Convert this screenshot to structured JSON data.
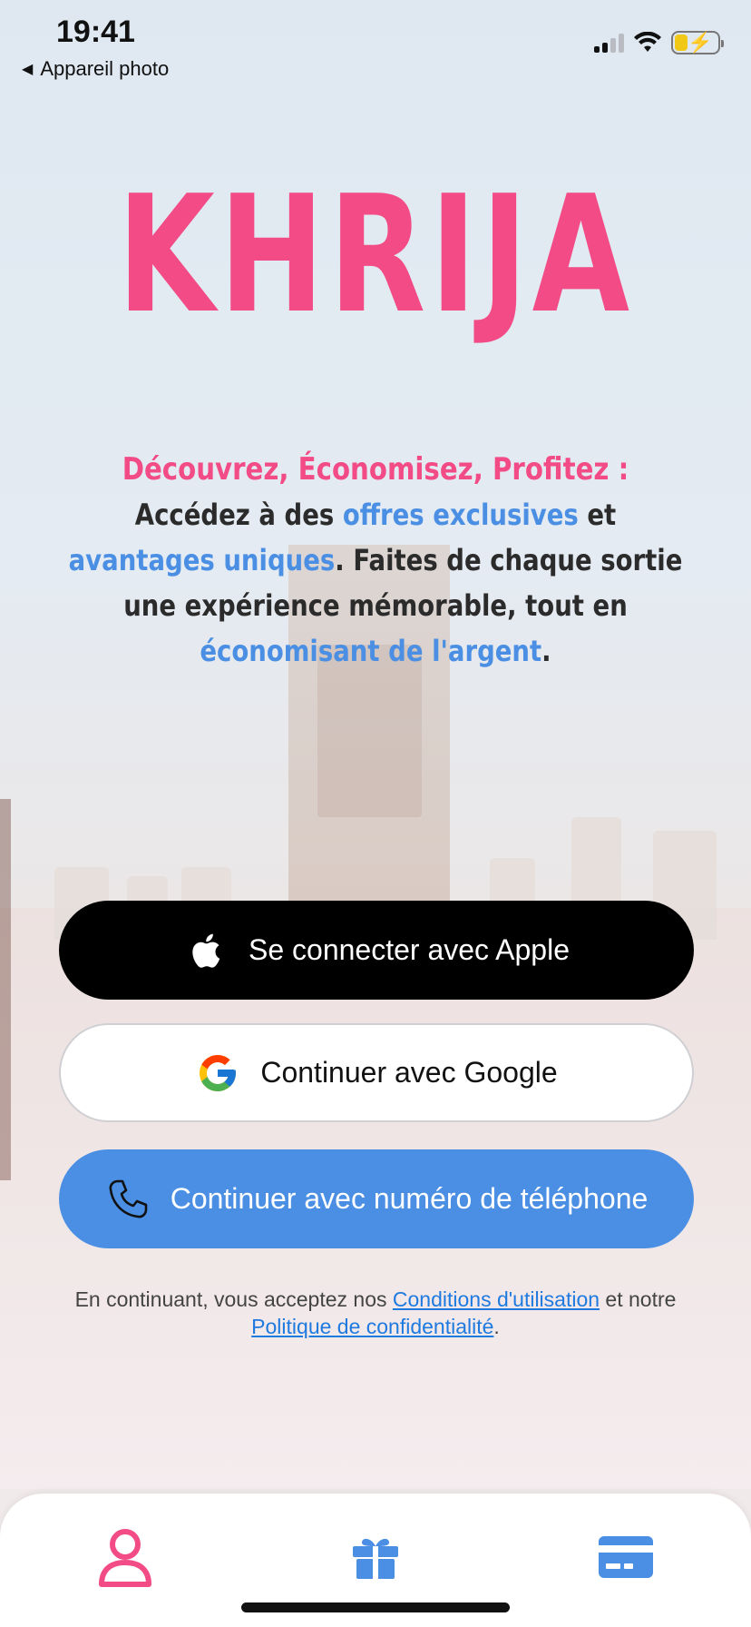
{
  "status_bar": {
    "time": "19:41",
    "back_app": "Appareil photo"
  },
  "logo": {
    "text": "KHRIJA",
    "color": "#f24b86"
  },
  "tagline": {
    "headline": "Découvrez, Économisez, Profitez :",
    "body_1": "Accédez à des ",
    "body_hl_1": "offres exclusives",
    "body_2": " et ",
    "body_hl_2": "avantages uniques",
    "body_3": ". Faites de chaque sortie une expérience mémorable, tout en ",
    "body_hl_3": "économisant de l'argent",
    "body_4": "."
  },
  "buttons": {
    "apple_label": "Se connecter avec Apple",
    "google_label": "Continuer avec Google",
    "phone_label": "Continuer avec numéro de téléphone"
  },
  "terms": {
    "prefix": "En continuant, vous acceptez nos ",
    "link_1": "Conditions d'utilisation",
    "middle": " et notre ",
    "link_2": "Politique de confidentialité",
    "suffix": "."
  },
  "tabbar": {
    "items": [
      {
        "icon": "user-icon",
        "active": true,
        "color": "#f24b86"
      },
      {
        "icon": "gift-icon",
        "active": false,
        "color": "#4a8fe3"
      },
      {
        "icon": "credit-card-icon",
        "active": false,
        "color": "#4a8fe3"
      }
    ]
  },
  "colors": {
    "accent_pink": "#f24b86",
    "accent_blue": "#4a8fe3",
    "apple_button": "#000000",
    "google_button": "#ffffff"
  }
}
